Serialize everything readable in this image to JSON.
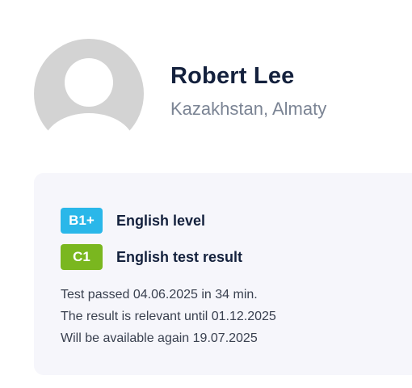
{
  "profile": {
    "name": "Robert Lee",
    "location": "Kazakhstan, Almaty",
    "avatar_icon": "user-silhouette-icon"
  },
  "results": {
    "level_badge": "B1+",
    "level_label": "English level",
    "test_badge": "C1",
    "test_label": "English test result",
    "info_lines": [
      "Test passed 04.06.2025 in 34 min.",
      "The result is relevant until 01.12.2025",
      "Will be available again 19.07.2025"
    ]
  },
  "colors": {
    "badge_blue": "#2ab7e9",
    "badge_green": "#7ab71f",
    "card_bg": "#f6f6fb",
    "avatar_bg": "#d3d3d3"
  }
}
